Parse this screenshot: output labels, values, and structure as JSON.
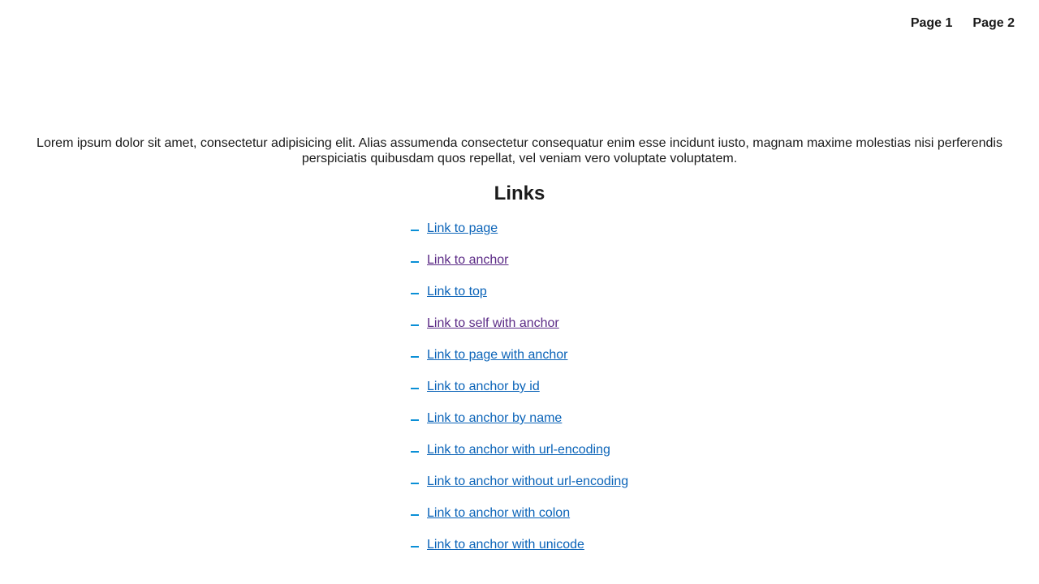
{
  "nav": {
    "page1": "Page 1",
    "page2": "Page 2"
  },
  "intro": "Lorem ipsum dolor sit amet, consectetur adipisicing elit. Alias assumenda consectetur consequatur enim esse incidunt iusto, magnam maxime molestias nisi perferendis perspiciatis quibusdam quos repellat, vel veniam vero voluptate voluptatem.",
  "heading": "Links",
  "colors": {
    "link": "#0a63b8",
    "visited_link": "#5b2a86",
    "bullet": "#0a8fd6"
  },
  "links": [
    {
      "label": "Link to page",
      "visited": false
    },
    {
      "label": "Link to anchor",
      "visited": true
    },
    {
      "label": "Link to top",
      "visited": false
    },
    {
      "label": "Link to self with anchor",
      "visited": true
    },
    {
      "label": "Link to page with anchor",
      "visited": false
    },
    {
      "label": "Link to anchor by id",
      "visited": false
    },
    {
      "label": "Link to anchor by name",
      "visited": false
    },
    {
      "label": "Link to anchor with url-encoding",
      "visited": false
    },
    {
      "label": "Link to anchor without url-encoding",
      "visited": false
    },
    {
      "label": "Link to anchor with colon",
      "visited": false
    },
    {
      "label": "Link to anchor with unicode",
      "visited": false
    }
  ]
}
